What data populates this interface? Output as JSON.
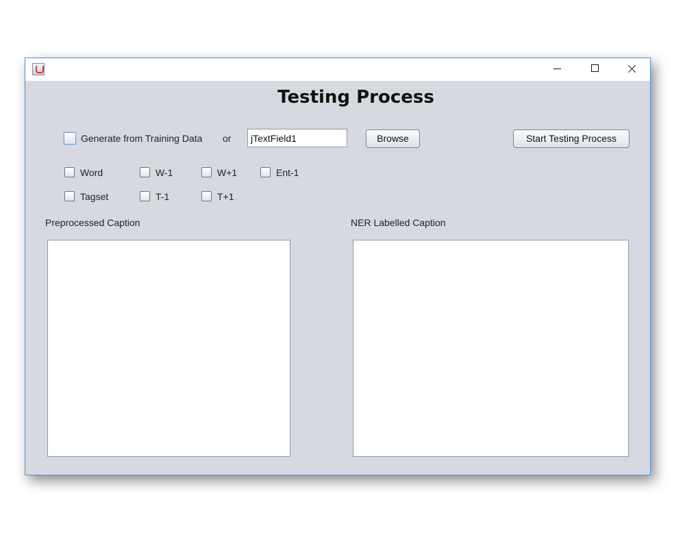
{
  "window": {
    "title": ""
  },
  "header": {
    "title": "Testing Process"
  },
  "controls": {
    "generate_checkbox_label": "Generate from Training Data",
    "or_label": "or",
    "file_field_value": "jTextField1",
    "browse_label": "Browse",
    "start_label": "Start Testing Process"
  },
  "features": {
    "row1": [
      "Word",
      "W-1",
      "W+1",
      "Ent-1"
    ],
    "row2": [
      "Tagset",
      "T-1",
      "T+1"
    ]
  },
  "panels": {
    "preprocessed_label": "Preprocessed Caption",
    "ner_label": "NER Labelled Caption"
  }
}
